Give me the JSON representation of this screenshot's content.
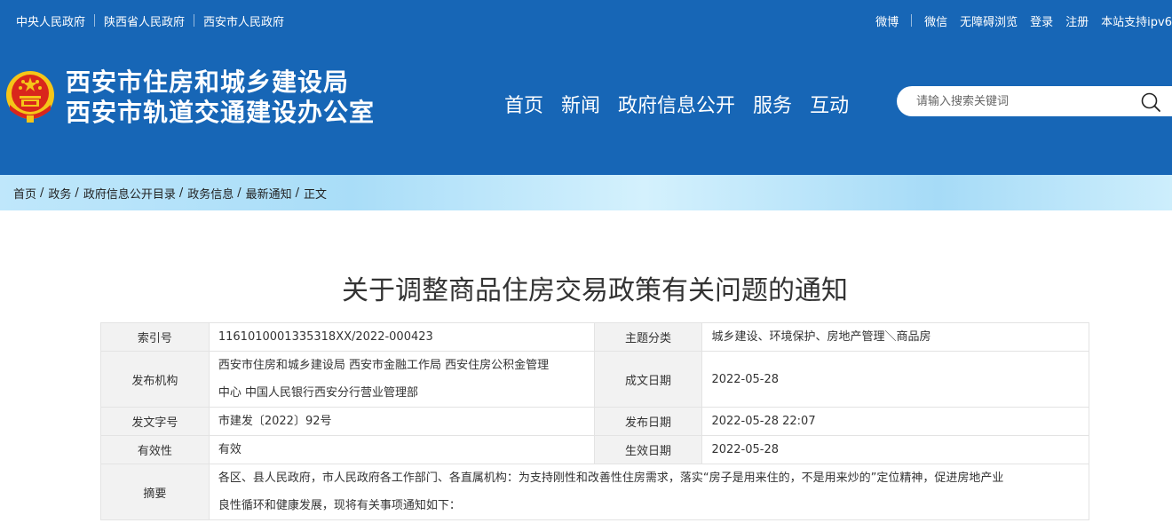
{
  "topbar": {
    "links": [
      "中央人民政府",
      "陕西省人民政府",
      "西安市人民政府"
    ],
    "right": {
      "weibo": "微博",
      "weixin": "微信",
      "accessible": "无障碍浏览",
      "login": "登录",
      "register": "注册",
      "ipv6": "本站支持ipv6"
    }
  },
  "header": {
    "title_line1": "西安市住房和城乡建设局",
    "title_line2": "西安市轨道交通建设办公室",
    "nav": [
      "首页",
      "新闻",
      "政府信息公开",
      "服务",
      "互动"
    ],
    "search_placeholder": "请输入搜索关键词"
  },
  "breadcrumb": [
    "首页",
    "政务",
    "政府信息公开目录",
    "政务信息",
    "最新通知",
    "正文"
  ],
  "article": {
    "title": "关于调整商品住房交易政策有关问题的通知",
    "meta": {
      "index_label": "索引号",
      "index_value": "1161010001335318XX/2022-000423",
      "topic_label": "主题分类",
      "topic_value": "城乡建设、环境保护、房地产管理＼商品房",
      "publisher_label": "发布机构",
      "publisher_line1": "西安市住房和城乡建设局 西安市金融工作局 西安住房公积金管理",
      "publisher_line2": "中心 中国人民银行西安分行营业管理部",
      "created_label": "成文日期",
      "created_value": "2022-05-28",
      "docno_label": "发文字号",
      "docno_value": "市建发〔2022〕92号",
      "published_label": "发布日期",
      "published_value": "2022-05-28 22:07",
      "validity_label": "有效性",
      "validity_value": "有效",
      "effective_label": "生效日期",
      "effective_value": "2022-05-28",
      "abstract_label": "摘要",
      "abstract_line1": "各区、县人民政府，市人民政府各工作部门、各直属机构：为支持刚性和改善性住房需求，落实“房子是用来住的，不是用来炒的”定位精神，促进房地产业",
      "abstract_line2": "良性循环和健康发展，现将有关事项通知如下："
    }
  },
  "colors": {
    "brand_blue": "#1766b6",
    "emblem_red": "#d9261c",
    "emblem_gold": "#f5c518"
  },
  "icons": {
    "emblem": "national-emblem-icon",
    "search": "search-icon"
  }
}
